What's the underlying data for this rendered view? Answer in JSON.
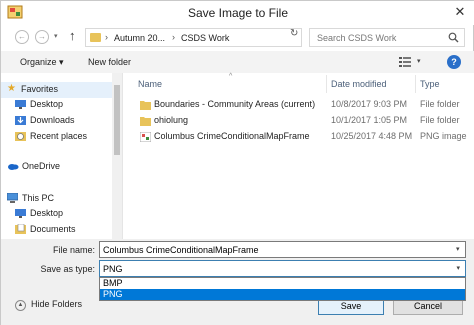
{
  "window": {
    "title": "Save Image to File"
  },
  "address": {
    "crumbs": [
      "Autumn 20...",
      "CSDS Work"
    ],
    "search_placeholder": "Search CSDS Work"
  },
  "toolbar": {
    "organize_label": "Organize ▾",
    "newfolder_label": "New folder"
  },
  "nav": {
    "items": [
      {
        "label": "Favorites"
      },
      {
        "label": "Desktop"
      },
      {
        "label": "Downloads"
      },
      {
        "label": "Recent places"
      },
      {
        "label": "OneDrive"
      },
      {
        "label": "This PC"
      },
      {
        "label": "Desktop"
      },
      {
        "label": "Documents"
      }
    ]
  },
  "columns": {
    "name": "Name",
    "date": "Date modified",
    "type": "Type"
  },
  "files": [
    {
      "name": "Boundaries - Community Areas (current)",
      "date": "10/8/2017 9:03 PM",
      "type": "File folder",
      "icon": "folder-icon"
    },
    {
      "name": "ohiolung",
      "date": "10/1/2017 1:05 PM",
      "type": "File folder",
      "icon": "folder-icon"
    },
    {
      "name": "Columbus CrimeConditionalMapFrame",
      "date": "10/25/2017 4:48 PM",
      "type": "PNG image",
      "icon": "image-file-icon"
    }
  ],
  "form": {
    "filename_label": "File name:",
    "filename_value": "Columbus CrimeConditionalMapFrame",
    "savetype_label": "Save as type:",
    "savetype_value": "PNG",
    "options": [
      "BMP",
      "PNG"
    ]
  },
  "buttons": {
    "save_label": "Save",
    "cancel_label": "Cancel",
    "hide_folders_label": "Hide Folders"
  },
  "colors": {
    "accent": "#0078d7",
    "folder": "#e8c35a"
  }
}
